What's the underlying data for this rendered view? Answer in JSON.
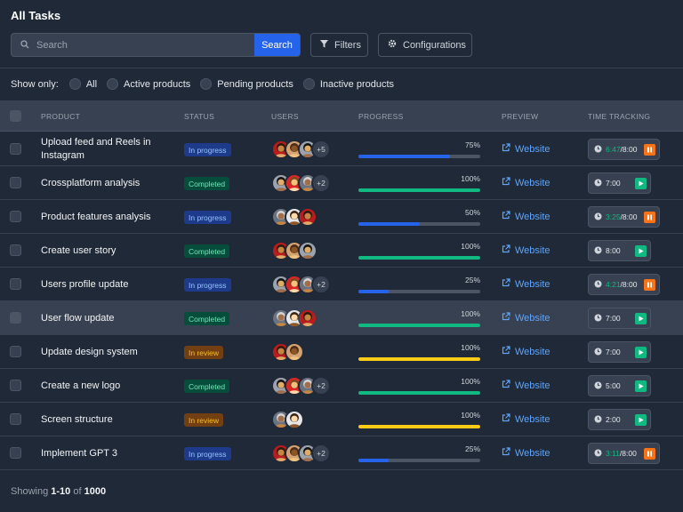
{
  "page": {
    "title": "All Tasks"
  },
  "search": {
    "placeholder": "Search",
    "button_label": "Search"
  },
  "toolbar": {
    "filters_label": "Filters",
    "configurations_label": "Configurations"
  },
  "show_only": {
    "label": "Show only:",
    "options": [
      "All",
      "Active products",
      "Pending products",
      "Inactive products"
    ]
  },
  "table": {
    "columns": [
      "PRODUCT",
      "STATUS",
      "USERS",
      "PROGRESS",
      "PREVIEW",
      "TIME TRACKING"
    ],
    "rows": [
      {
        "product": "Upload feed and Reels in Instagram",
        "status": "In progress",
        "status_type": "progress",
        "avatars": 3,
        "extra_users": "+5",
        "progress": 75,
        "progress_label": "75%",
        "preview": "Website",
        "time_elapsed": "6:47",
        "time_total": "/8:00",
        "time_display": "",
        "timer_state": "running"
      },
      {
        "product": "Crossplatform analysis",
        "status": "Completed",
        "status_type": "completed",
        "avatars": 3,
        "extra_users": "+2",
        "progress": 100,
        "progress_label": "100%",
        "preview": "Website",
        "time_elapsed": "",
        "time_total": "",
        "time_display": "7:00",
        "timer_state": "stopped"
      },
      {
        "product": "Product features analysis",
        "status": "In progress",
        "status_type": "progress",
        "avatars": 3,
        "extra_users": "",
        "progress": 50,
        "progress_label": "50%",
        "preview": "Website",
        "time_elapsed": "3:25",
        "time_total": "/8:00",
        "time_display": "",
        "timer_state": "running"
      },
      {
        "product": "Create user story",
        "status": "Completed",
        "status_type": "completed",
        "avatars": 3,
        "extra_users": "",
        "progress": 100,
        "progress_label": "100%",
        "preview": "Website",
        "time_elapsed": "",
        "time_total": "",
        "time_display": "8:00",
        "timer_state": "stopped"
      },
      {
        "product": "Users profile update",
        "status": "In progress",
        "status_type": "progress",
        "avatars": 3,
        "extra_users": "+2",
        "progress": 25,
        "progress_label": "25%",
        "preview": "Website",
        "time_elapsed": "4:21",
        "time_total": "/8:00",
        "time_display": "",
        "timer_state": "running"
      },
      {
        "product": "User flow update",
        "status": "Completed",
        "status_type": "completed",
        "avatars": 3,
        "extra_users": "",
        "progress": 100,
        "progress_label": "100%",
        "preview": "Website",
        "time_elapsed": "",
        "time_total": "",
        "time_display": "7:00",
        "timer_state": "stopped",
        "highlighted": true
      },
      {
        "product": "Update design system",
        "status": "In review",
        "status_type": "review",
        "avatars": 2,
        "extra_users": "",
        "progress": 100,
        "progress_label": "100%",
        "preview": "Website",
        "time_elapsed": "",
        "time_total": "",
        "time_display": "7:00",
        "timer_state": "stopped"
      },
      {
        "product": "Create a new logo",
        "status": "Completed",
        "status_type": "completed",
        "avatars": 3,
        "extra_users": "+2",
        "progress": 100,
        "progress_label": "100%",
        "preview": "Website",
        "time_elapsed": "",
        "time_total": "",
        "time_display": "5:00",
        "timer_state": "stopped"
      },
      {
        "product": "Screen structure",
        "status": "In review",
        "status_type": "review",
        "avatars": 2,
        "extra_users": "",
        "progress": 100,
        "progress_label": "100%",
        "preview": "Website",
        "time_elapsed": "",
        "time_total": "",
        "time_display": "2:00",
        "timer_state": "stopped"
      },
      {
        "product": "Implement GPT 3",
        "status": "In progress",
        "status_type": "progress",
        "avatars": 3,
        "extra_users": "+2",
        "progress": 25,
        "progress_label": "25%",
        "preview": "Website",
        "time_elapsed": "3:11",
        "time_total": "/8:00",
        "time_display": "",
        "timer_state": "running"
      }
    ]
  },
  "footer": {
    "prefix": "Showing ",
    "range": "1-10",
    "of": " of ",
    "total": "1000"
  },
  "colors": {
    "accent": "#2563eb",
    "bar_progress": "#2563eb",
    "bar_completed": "#10b981",
    "bar_review": "#facc15",
    "timer_running": "#f97316",
    "timer_stopped": "#10b981"
  }
}
